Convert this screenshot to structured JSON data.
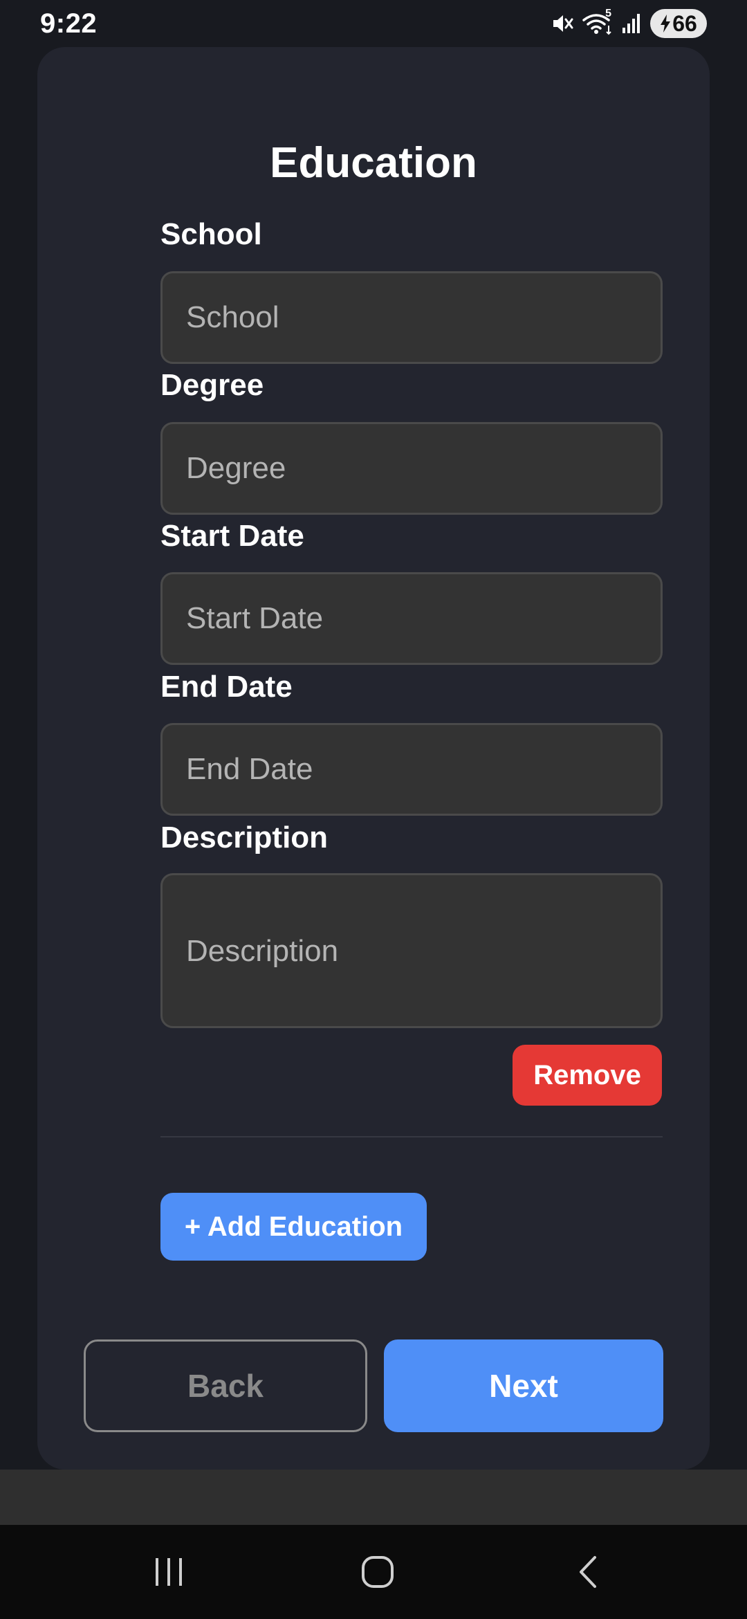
{
  "status_bar": {
    "time": "9:22",
    "battery_level": "66",
    "wifi_badge": "5",
    "icons": [
      "mute-icon",
      "wifi-icon",
      "signal-icon",
      "battery-charging-icon"
    ]
  },
  "page": {
    "title": "Education"
  },
  "fields": {
    "school": {
      "label": "School",
      "placeholder": "School",
      "value": ""
    },
    "degree": {
      "label": "Degree",
      "placeholder": "Degree",
      "value": ""
    },
    "start_date": {
      "label": "Start Date",
      "placeholder": "Start Date",
      "value": ""
    },
    "end_date": {
      "label": "End Date",
      "placeholder": "End Date",
      "value": ""
    },
    "description": {
      "label": "Description",
      "placeholder": "Description",
      "value": ""
    }
  },
  "actions": {
    "remove_label": "Remove",
    "add_label": "+ Add Education",
    "back_label": "Back",
    "next_label": "Next"
  },
  "navigation": {
    "icons": [
      "recent-apps-icon",
      "home-icon",
      "back-icon"
    ]
  },
  "colors": {
    "background": "#181a20",
    "card": "#23252f",
    "input_bg": "#333333",
    "primary": "#4f8ff7",
    "danger": "#e53935"
  }
}
